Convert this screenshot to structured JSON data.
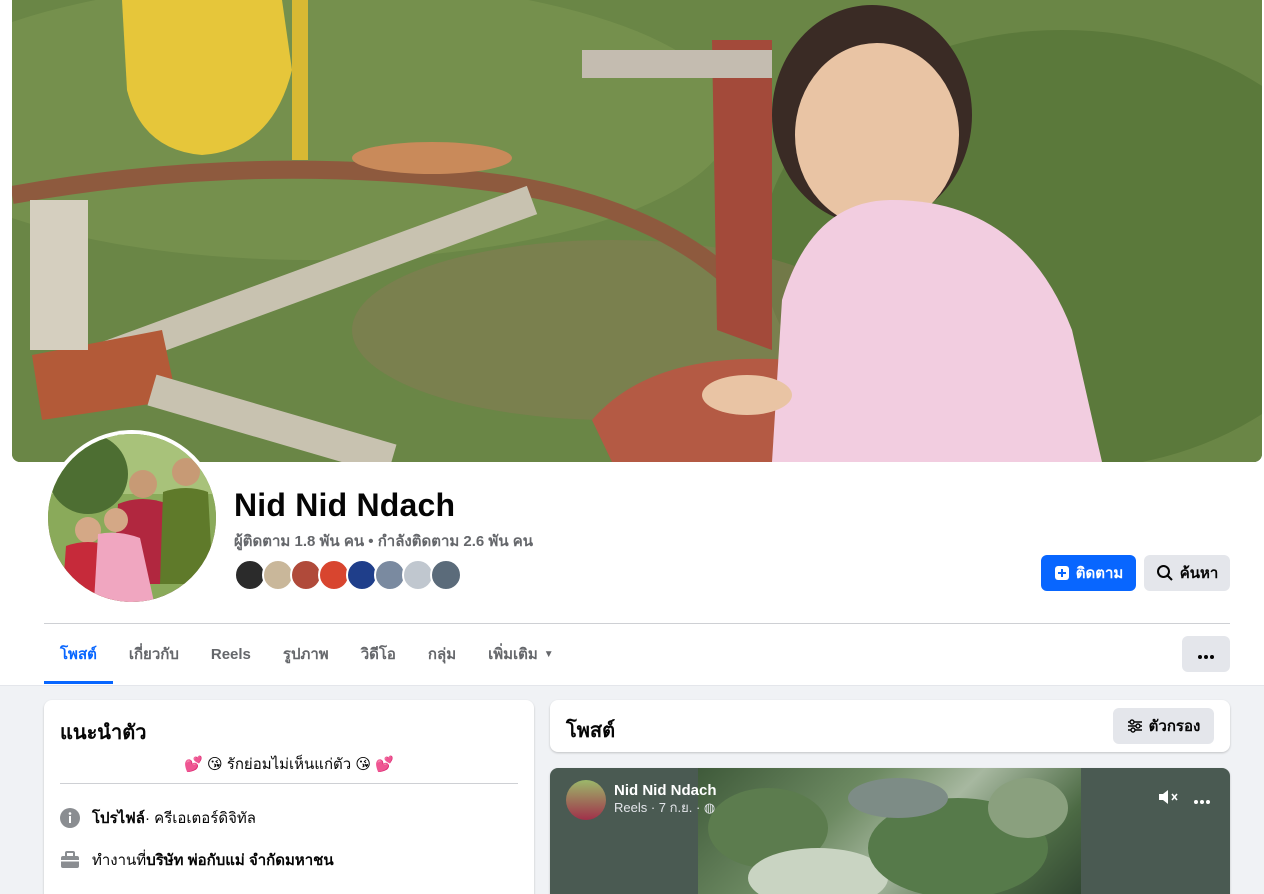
{
  "profile": {
    "name": "Nid Nid Ndach",
    "follow_stats": "ผู้ติดตาม 1.8 พัน คน • กำลังติดตาม 2.6 พัน คน",
    "friend_avatars": [
      "#2b2b2b",
      "#c9b79a",
      "#b04a3a",
      "#d8452f",
      "#1f3e8a",
      "#7a8aa0",
      "#c0c7cf",
      "#5b6b7a"
    ]
  },
  "actions": {
    "follow_label": "ติดตาม",
    "search_label": "ค้นหา",
    "follow_icon": "add-friend-icon",
    "search_icon": "search-icon",
    "more_icon": "more-icon"
  },
  "tabs": [
    {
      "label": "โพสต์"
    },
    {
      "label": "เกี่ยวกับ"
    },
    {
      "label": "Reels"
    },
    {
      "label": "รูปภาพ"
    },
    {
      "label": "วิดีโอ"
    },
    {
      "label": "กลุ่ม"
    },
    {
      "label": "เพิ่มเติม"
    }
  ],
  "intro": {
    "title": "แนะนำตัว",
    "bio": "💕 😘 รักย่อมไม่เห็นแก่ตัว 😘 💕",
    "rows": [
      {
        "prefix": "โปรไฟล์",
        "text": " · ครีเอเตอร์ดิจิทัล"
      },
      {
        "prefix": "ทำงานที่ ",
        "bold": "บริษัท พ่อกับแม่ จำกัดมหาชน"
      }
    ]
  },
  "posts": {
    "title": "โพสต์",
    "filter_label": "ตัวกรอง"
  },
  "reel": {
    "author": "Nid Nid Ndach",
    "meta": "Reels · 7 ก.ย. ·"
  },
  "colors": {
    "accent": "#0866ff",
    "secondary_button": "#e4e6eb",
    "muted_text": "#65676b",
    "page_bg": "#f0f2f5"
  }
}
